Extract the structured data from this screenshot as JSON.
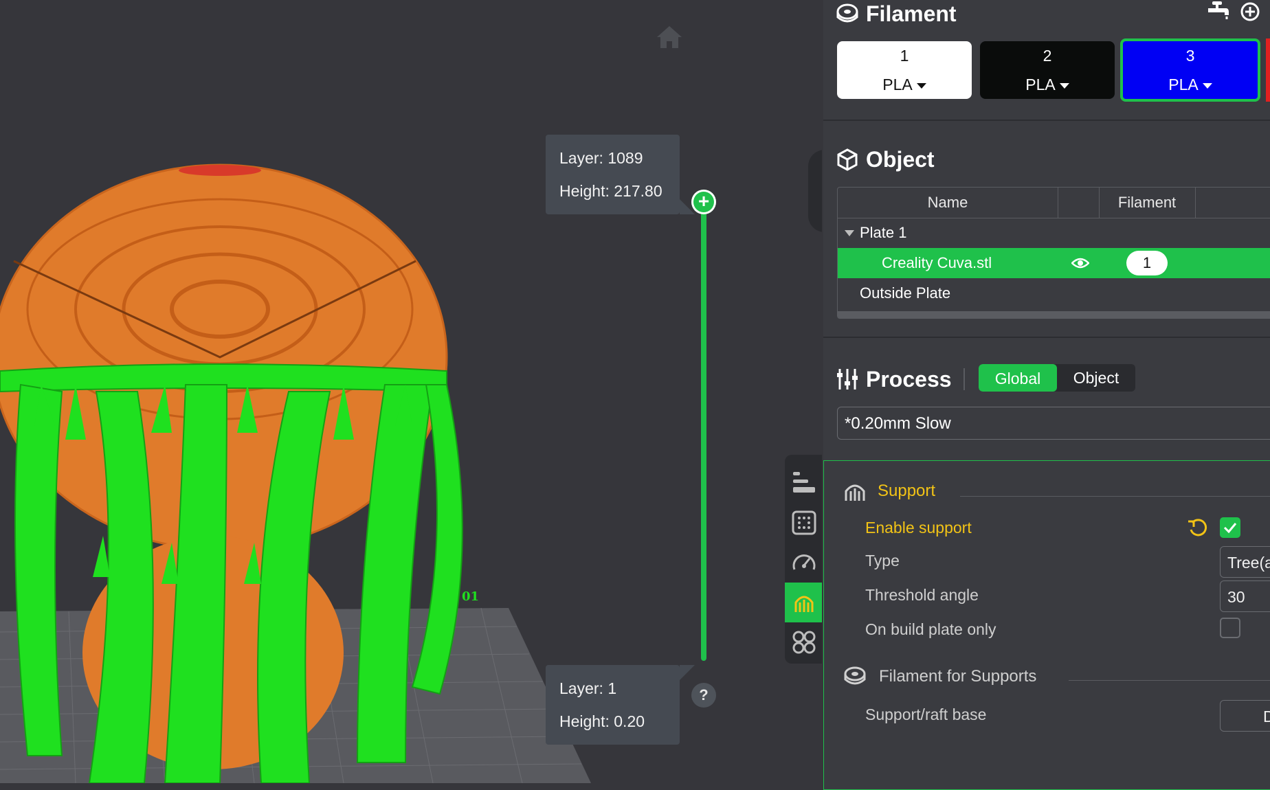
{
  "viewport": {
    "top_tooltip": {
      "layer": "Layer: 1089",
      "height": "Height: 217.80"
    },
    "bottom_tooltip": {
      "layer": "Layer: 1",
      "height": "Height: 0.20"
    },
    "slider_thumb_symbol": "+",
    "help_symbol": "?",
    "plate_number_label": "01",
    "colors": {
      "model": "#e07b2b",
      "support": "#1fe01f",
      "slider": "#1fc14b"
    }
  },
  "filament": {
    "title": "Filament",
    "slots": [
      {
        "index": "1",
        "type": "PLA",
        "color": "#ffffff"
      },
      {
        "index": "2",
        "type": "PLA",
        "color": "#0a0c0b"
      },
      {
        "index": "3",
        "type": "PLA",
        "color": "#0000f4"
      }
    ]
  },
  "object": {
    "title": "Object",
    "columns": [
      "Name",
      "",
      "Filament",
      ""
    ],
    "rows": [
      {
        "name": "Plate 1"
      },
      {
        "name": "Creality Cuva.stl",
        "filament": "1"
      },
      {
        "name": "Outside Plate"
      }
    ]
  },
  "process": {
    "title": "Process",
    "tabs": [
      "Global",
      "Object"
    ],
    "active_tab": "Global",
    "preset": "*0.20mm Slow"
  },
  "settings": {
    "support_group": "Support",
    "enable_support": "Enable support",
    "type_label": "Type",
    "type_value": "Tree(auto)",
    "threshold_label": "Threshold angle",
    "threshold_value": "30",
    "build_plate_only": "On build plate only",
    "filament_group": "Filament for Supports",
    "raft_base": "Support/raft base",
    "raft_value": "Default"
  },
  "accent_colors": {
    "primary": "#1fc14b",
    "modified": "#f2c316"
  }
}
